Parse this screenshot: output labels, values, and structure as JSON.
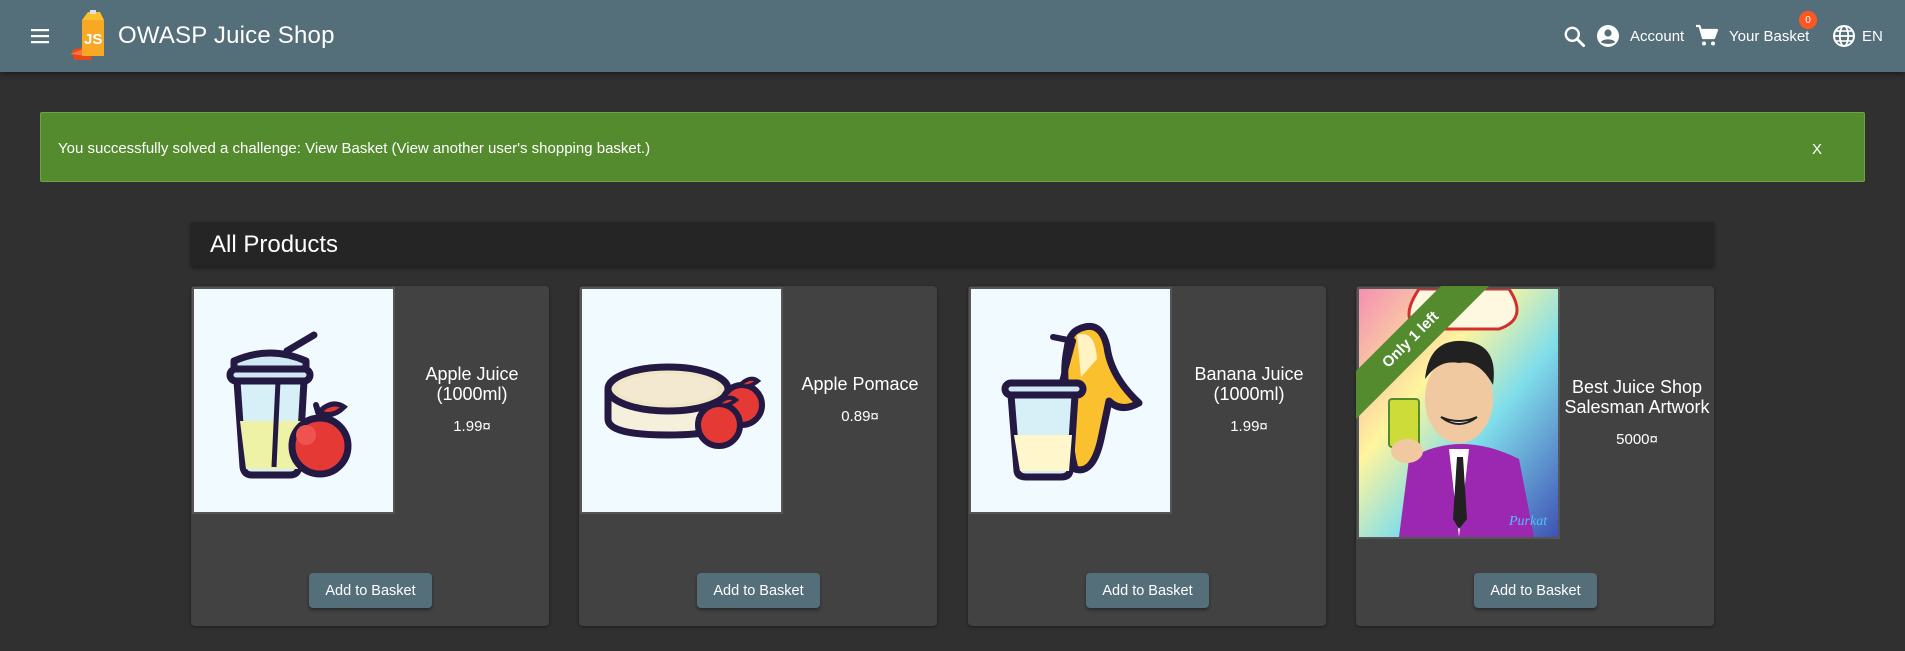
{
  "header": {
    "title": "OWASP Juice Shop",
    "account_label": "Account",
    "basket_label": "Your Basket",
    "basket_count": "0",
    "language_label": "EN"
  },
  "snackbar": {
    "message": "You successfully solved a challenge: View Basket (View another user's shopping basket.)",
    "close_label": "X"
  },
  "products": {
    "heading": "All Products",
    "add_label": "Add to Basket",
    "items": [
      {
        "name": "Apple Juice (1000ml)",
        "price": "1.99¤",
        "image": "apple-juice-illustration"
      },
      {
        "name": "Apple Pomace",
        "price": "0.89¤",
        "image": "apple-pomace-illustration"
      },
      {
        "name": "Banana Juice (1000ml)",
        "price": "1.99¤",
        "image": "banana-juice-illustration"
      },
      {
        "name": "Best Juice Shop Salesman Artwork",
        "price": "5000¤",
        "image": "salesman-artwork",
        "ribbon": "Only 1 left"
      }
    ]
  },
  "colors": {
    "toolbar": "#546e7a",
    "success": "#558b2f",
    "background": "#303030",
    "card": "#424242",
    "badge": "#ff5722"
  }
}
